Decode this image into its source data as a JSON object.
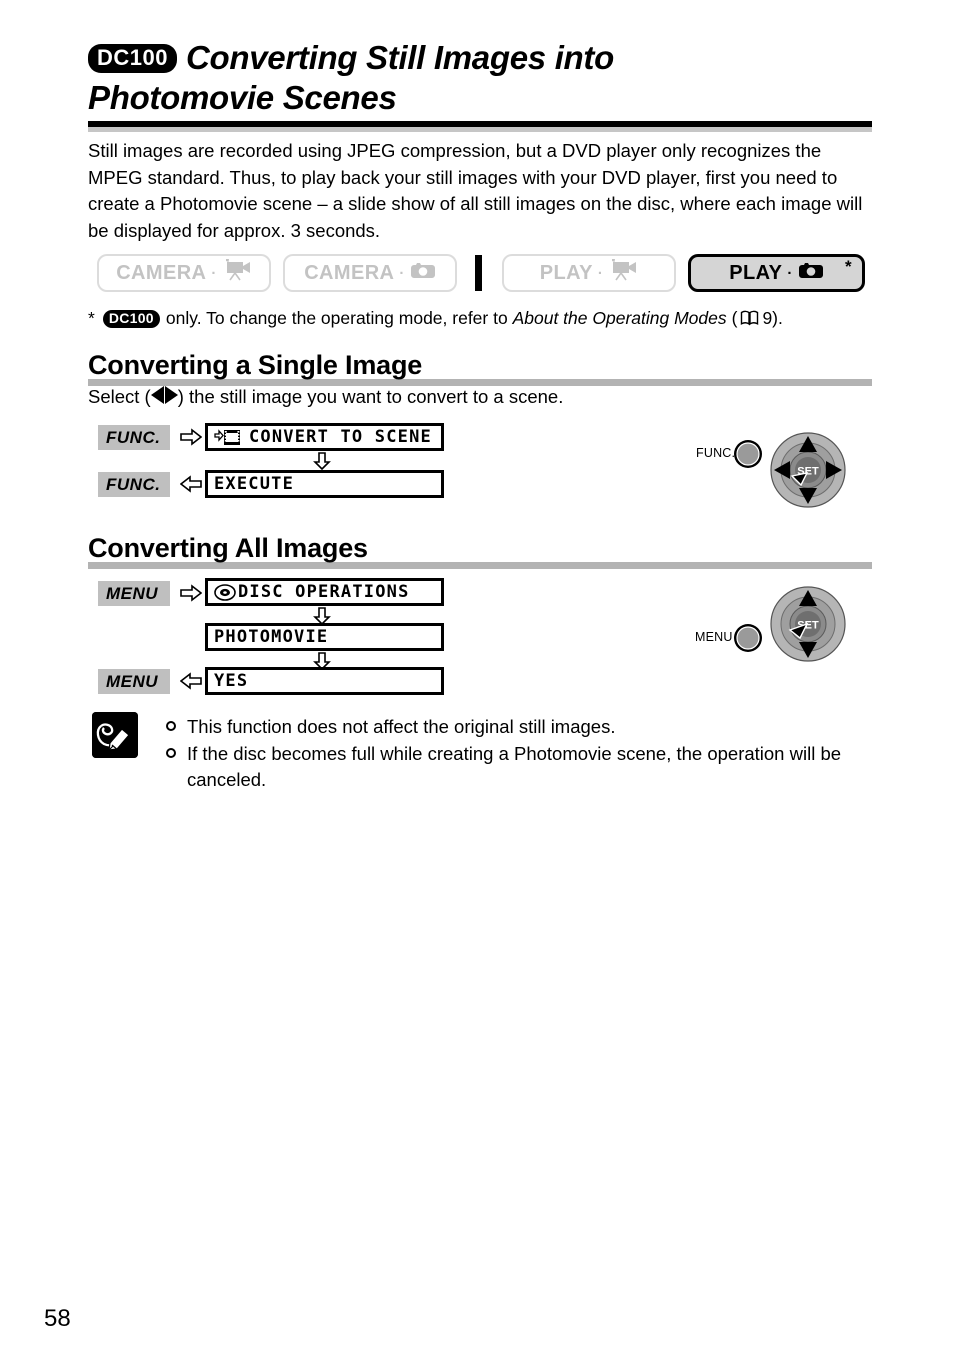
{
  "page": {
    "number": "58",
    "model_badge": "DC100"
  },
  "title": {
    "badge": "DC100",
    "line1": "Converting Still Images into",
    "line2": "Photomovie Scenes"
  },
  "intro": {
    "text": "Still images are recorded using JPEG compression, but a DVD player only recognizes the MPEG standard. Thus, to play back your still images with your DVD player, first you need to create a Photomovie scene – a slide show of all still images on the disc, where each image will be displayed for approx. 3 seconds."
  },
  "mode_bar": {
    "buttons": [
      {
        "label": "CAMERA",
        "icon": "movie-camera-icon",
        "state": "inactive"
      },
      {
        "label": "CAMERA",
        "icon": "still-camera-icon",
        "state": "inactive"
      },
      {
        "label": "PLAY",
        "icon": "movie-camera-icon",
        "state": "inactive"
      },
      {
        "label": "PLAY",
        "icon": "still-camera-icon",
        "state": "active"
      }
    ],
    "active_marker": "*"
  },
  "footnote": {
    "star": "*",
    "badge": "DC100",
    "before_italic": "only. To change the operating mode, refer to ",
    "italic": "About the Operating Modes",
    "open_paren": "(",
    "page_ref": "9",
    "close_paren": ")."
  },
  "section_single": {
    "heading": "Converting a Single Image",
    "select_prefix": "Select (",
    "select_suffix": ") the still image you want to convert to a scene.",
    "steps": [
      {
        "key": "FUNC.",
        "arrow": "right",
        "icon": "convert-to-scene-icon",
        "label": "CONVERT TO SCENE"
      },
      {
        "key": "FUNC.",
        "arrow": "left",
        "icon": null,
        "label": "EXECUTE"
      }
    ],
    "joystick": {
      "button_label": "FUNC.",
      "set_label": "SET"
    }
  },
  "section_all": {
    "heading": "Converting All Images",
    "steps": [
      {
        "key": "MENU",
        "arrow": "right",
        "icon": "disc-icon",
        "label": "DISC OPERATIONS"
      },
      {
        "key": "",
        "arrow": "none",
        "icon": null,
        "label": "PHOTOMOVIE"
      },
      {
        "key": "MENU",
        "arrow": "left",
        "icon": null,
        "label": "YES"
      }
    ],
    "joystick": {
      "button_label": "MENU",
      "set_label": "SET"
    }
  },
  "notes": {
    "icon": "memo-pencil-icon",
    "items": [
      "This function does not affect the original still images.",
      "If the disc becomes full while creating a Photomovie scene, the operation will be canceled."
    ]
  },
  "colors": {
    "rule_black": "#000000",
    "rule_gray": "#c6c6c6",
    "section_bar_gray": "#b3b3b3",
    "key_tag_gray": "#bfbfbf",
    "inactive_button": "#c3c3c3",
    "active_button_fill": "#d5d5d5"
  }
}
